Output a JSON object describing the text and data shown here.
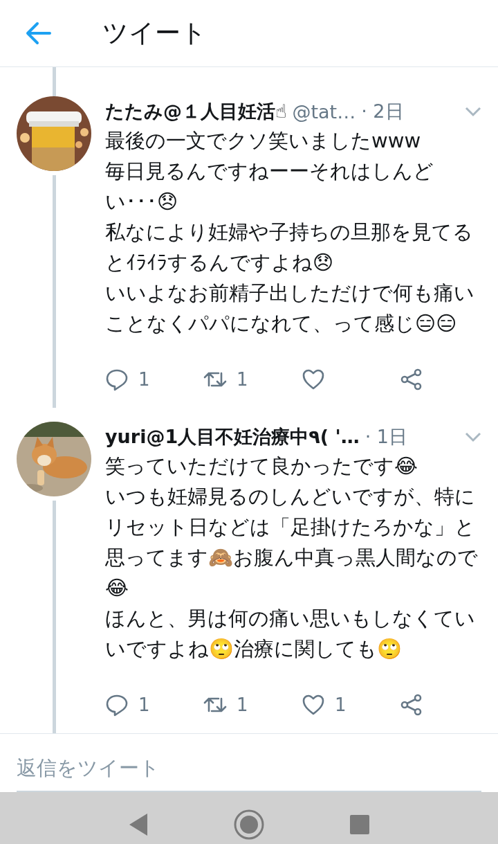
{
  "header": {
    "title": "ツイート"
  },
  "tweets": [
    {
      "name": "たたみ@１人目妊活☝",
      "handle": "@tat…",
      "time": "· 2日",
      "body": [
        "最後の一文でクソ笑いましたwww",
        "毎日見るんですねーーそれはしんどい･･･😞",
        "私なにより妊婦や子持ちの旦那を見てるとｲﾗｲﾗするんですよね😞",
        "いいよなお前精子出しただけで何も痛いことなくパパになれて、って感じ😑😑"
      ],
      "replies": "1",
      "retweets": "1"
    },
    {
      "name": "yuri@1人目不妊治療中٩( '…",
      "time": "· 1日",
      "body": [
        "笑っていただけて良かったです😂",
        "いつも妊婦見るのしんどいですが、特にリセット日などは「足掛けたろかな」と思ってます🙈お腹ん中真っ黒人間なので😂",
        "ほんと、男は何の痛い思いもしなくていいですよね🙄治療に関しても🙄"
      ],
      "replies": "1",
      "retweets": "1",
      "likes": "1"
    }
  ],
  "reply": {
    "placeholder": "返信をツイート"
  }
}
